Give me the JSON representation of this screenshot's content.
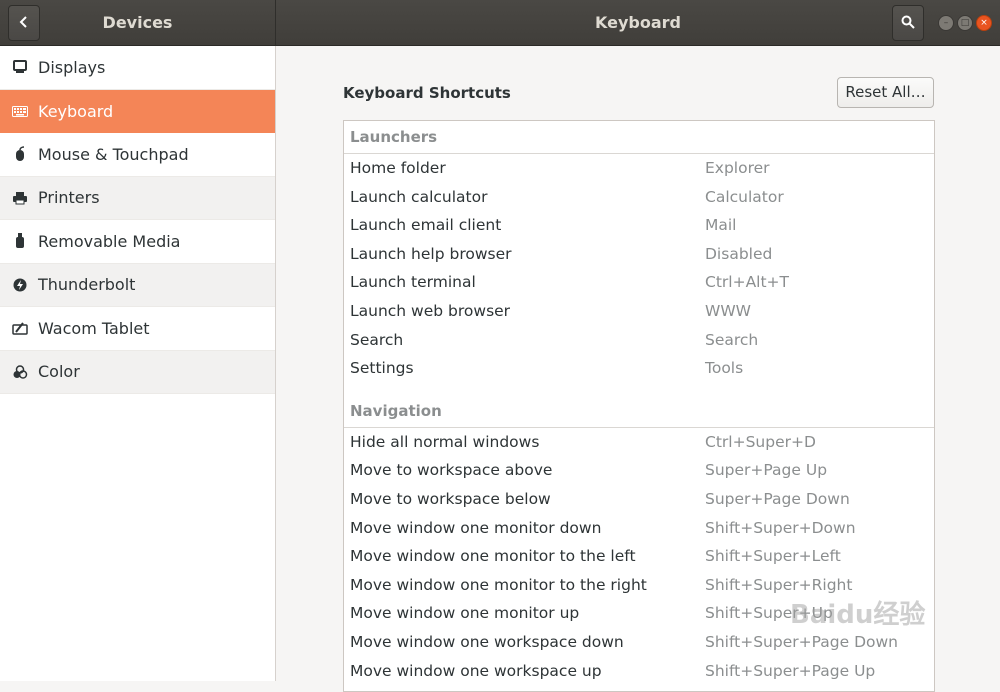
{
  "header": {
    "left_title": "Devices",
    "main_title": "Keyboard"
  },
  "sidebar": {
    "items": [
      {
        "label": "Displays",
        "icon": "display-icon"
      },
      {
        "label": "Keyboard",
        "icon": "keyboard-icon",
        "selected": true
      },
      {
        "label": "Mouse & Touchpad",
        "icon": "mouse-icon"
      },
      {
        "label": "Printers",
        "icon": "printer-icon"
      },
      {
        "label": "Removable Media",
        "icon": "usb-drive-icon"
      },
      {
        "label": "Thunderbolt",
        "icon": "thunderbolt-icon"
      },
      {
        "label": "Wacom Tablet",
        "icon": "tablet-icon"
      },
      {
        "label": "Color",
        "icon": "color-icon"
      }
    ]
  },
  "main": {
    "section_title": "Keyboard Shortcuts",
    "reset_label": "Reset All…",
    "groups": [
      {
        "title": "Launchers",
        "rows": [
          {
            "name": "Home folder",
            "accel": "Explorer"
          },
          {
            "name": "Launch calculator",
            "accel": "Calculator"
          },
          {
            "name": "Launch email client",
            "accel": "Mail"
          },
          {
            "name": "Launch help browser",
            "accel": "Disabled"
          },
          {
            "name": "Launch terminal",
            "accel": "Ctrl+Alt+T"
          },
          {
            "name": "Launch web browser",
            "accel": "WWW"
          },
          {
            "name": "Search",
            "accel": "Search"
          },
          {
            "name": "Settings",
            "accel": "Tools"
          }
        ]
      },
      {
        "title": "Navigation",
        "rows": [
          {
            "name": "Hide all normal windows",
            "accel": "Ctrl+Super+D"
          },
          {
            "name": "Move to workspace above",
            "accel": "Super+Page Up"
          },
          {
            "name": "Move to workspace below",
            "accel": "Super+Page Down"
          },
          {
            "name": "Move window one monitor down",
            "accel": "Shift+Super+Down"
          },
          {
            "name": "Move window one monitor to the left",
            "accel": "Shift+Super+Left"
          },
          {
            "name": "Move window one monitor to the right",
            "accel": "Shift+Super+Right"
          },
          {
            "name": "Move window one monitor up",
            "accel": "Shift+Super+Up"
          },
          {
            "name": "Move window one workspace down",
            "accel": "Shift+Super+Page Down"
          },
          {
            "name": "Move window one workspace up",
            "accel": "Shift+Super+Page Up"
          }
        ]
      }
    ]
  },
  "watermark": "Baidu经验",
  "colors": {
    "accent": "#f48557",
    "titlebar": "#403e3a",
    "close": "#e95420"
  }
}
